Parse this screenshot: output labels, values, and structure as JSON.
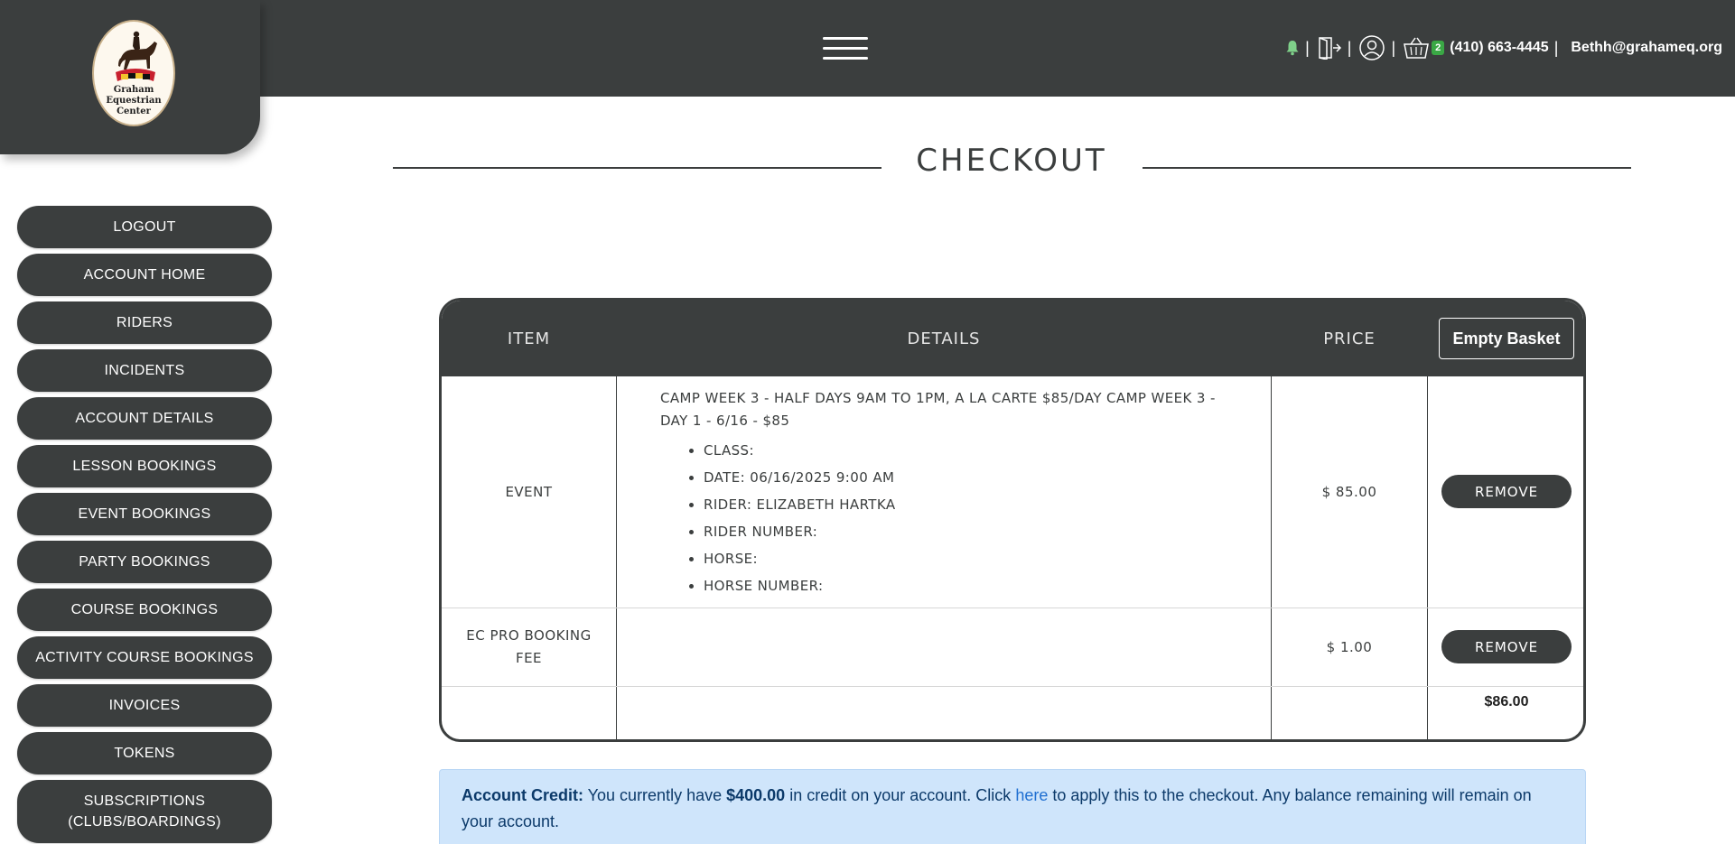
{
  "header": {
    "phone": "(410) 663-4445",
    "email": "Bethh@grahameq.org",
    "basket_count": "2",
    "separator": "|",
    "logo_text": [
      "Graham",
      "Equestrian",
      "Center"
    ]
  },
  "sidebar": {
    "items": [
      {
        "label": "LOGOUT"
      },
      {
        "label": "ACCOUNT HOME"
      },
      {
        "label": "RIDERS"
      },
      {
        "label": "INCIDENTS"
      },
      {
        "label": "ACCOUNT DETAILS"
      },
      {
        "label": "LESSON BOOKINGS"
      },
      {
        "label": "EVENT BOOKINGS"
      },
      {
        "label": "PARTY BOOKINGS"
      },
      {
        "label": "COURSE BOOKINGS"
      },
      {
        "label": "ACTIVITY COURSE BOOKINGS"
      },
      {
        "label": "INVOICES"
      },
      {
        "label": "TOKENS"
      },
      {
        "label_line1": "SUBSCRIPTIONS",
        "label_line2": "(CLUBS/BOARDINGS)"
      }
    ]
  },
  "page": {
    "title": "CHECKOUT"
  },
  "basket": {
    "columns": [
      "ITEM",
      "DETAILS",
      "PRICE"
    ],
    "empty_label": "Empty Basket",
    "remove_label": "REMOVE",
    "rows": [
      {
        "item": "EVENT",
        "title": "CAMP WEEK 3 - HALF DAYS 9AM TO 1PM, A LA CARTE $85/DAY CAMP WEEK 3 - DAY 1 - 6/16 - $85",
        "details": [
          "CLASS:",
          "DATE: 06/16/2025 9:00 AM",
          "RIDER: ELIZABETH HARTKA",
          "RIDER NUMBER:",
          "HORSE:",
          "HORSE NUMBER:"
        ],
        "price": "$ 85.00"
      },
      {
        "item_line1": "EC PRO BOOKING",
        "item_line2": "FEE",
        "price": "$ 1.00"
      }
    ],
    "total": "$86.00"
  },
  "credit": {
    "label": "Account Credit:",
    "text1": " You currently have ",
    "amount": "$400.00",
    "text2": " in credit on your account. Click ",
    "link": "here",
    "text3": " to apply this to the checkout. Any balance remaining will remain on your account."
  },
  "colors": {
    "dark": "#3b3e3e",
    "alert_bg": "#cfe5fb",
    "badge": "#3aa845",
    "bell": "#7fd18a"
  }
}
